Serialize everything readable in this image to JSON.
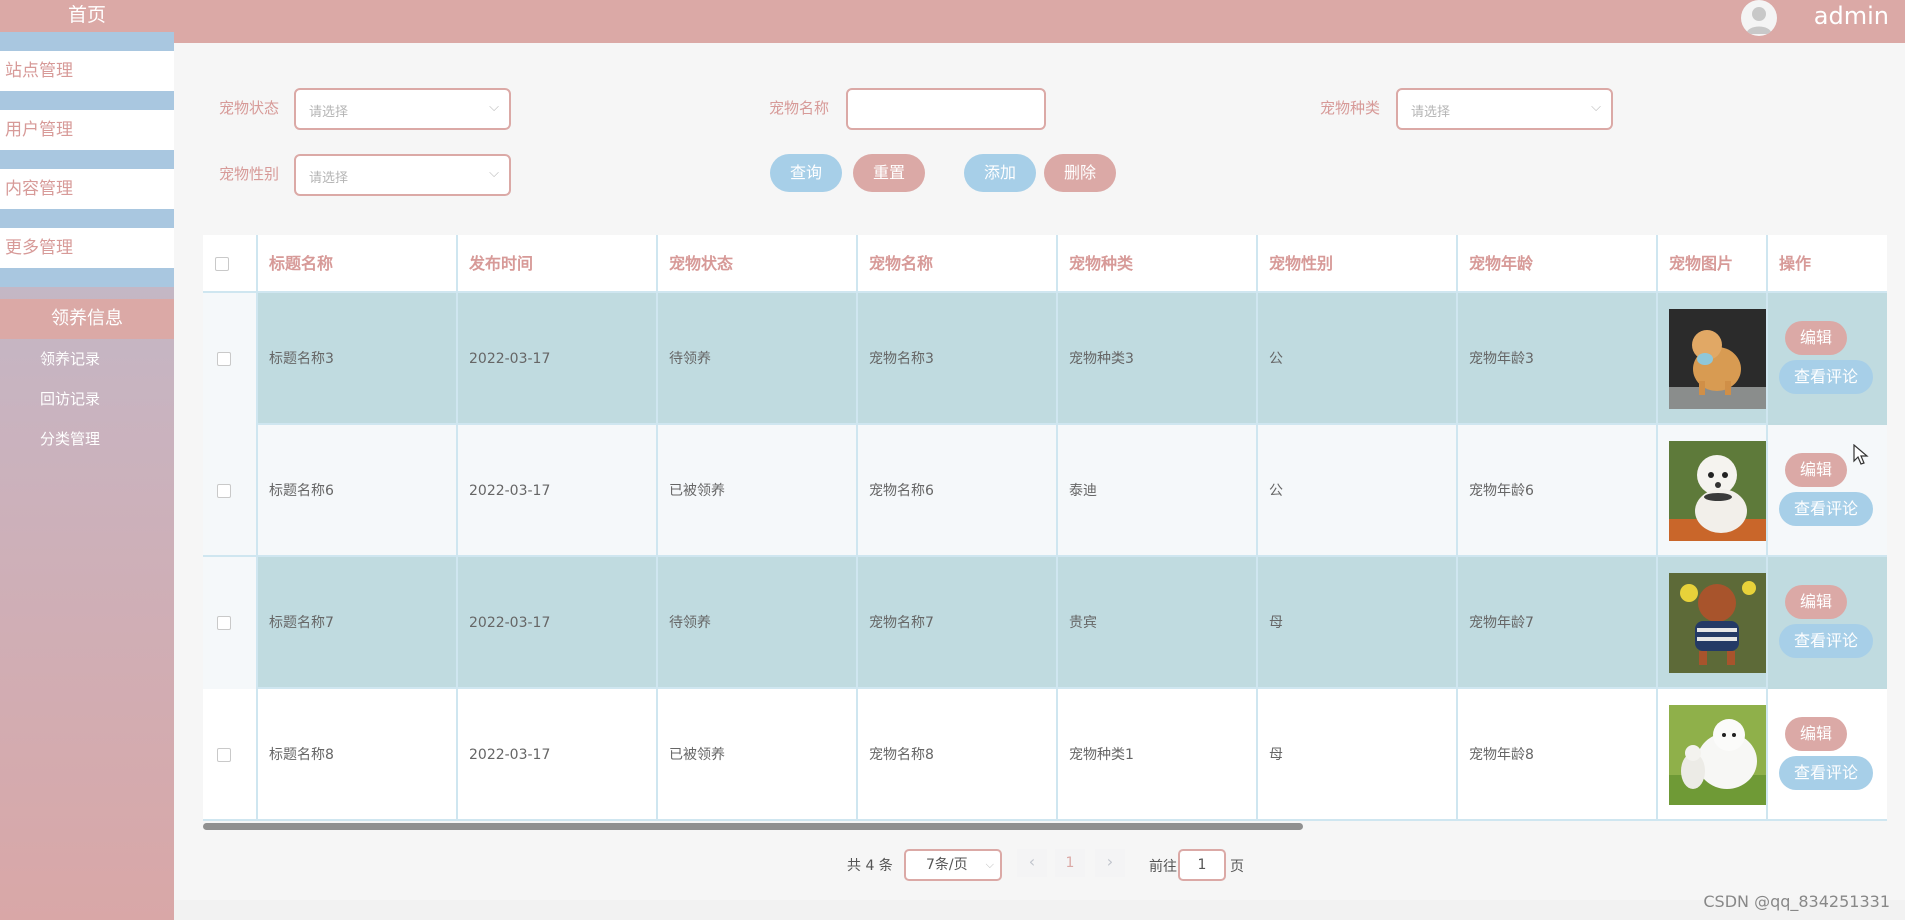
{
  "sidebar": {
    "home": "首页",
    "menus": [
      "站点管理",
      "用户管理",
      "内容管理",
      "更多管理"
    ],
    "active_group": "领养信息",
    "sub_items": [
      "领养记录",
      "回访记录",
      "分类管理"
    ]
  },
  "header": {
    "username": "admin"
  },
  "filters": {
    "status_label": "宠物状态",
    "status_placeholder": "请选择",
    "name_label": "宠物名称",
    "name_value": "",
    "type_label": "宠物种类",
    "type_placeholder": "请选择",
    "gender_label": "宠物性别",
    "gender_placeholder": "请选择"
  },
  "buttons": {
    "query": "查询",
    "reset": "重置",
    "add": "添加",
    "delete": "删除"
  },
  "table": {
    "columns": [
      "标题名称",
      "发布时间",
      "宠物状态",
      "宠物名称",
      "宠物种类",
      "宠物性别",
      "宠物年龄",
      "宠物图片",
      "操作"
    ],
    "rows": [
      {
        "title": "标题名称3",
        "date": "2022-03-17",
        "status": "待领养",
        "name": "宠物名称3",
        "type": "宠物种类3",
        "gender": "公",
        "age": "宠物年龄3",
        "edit": "编辑",
        "view": "查看评论"
      },
      {
        "title": "标题名称6",
        "date": "2022-03-17",
        "status": "已被领养",
        "name": "宠物名称6",
        "type": "泰迪",
        "gender": "公",
        "age": "宠物年龄6",
        "edit": "编辑",
        "view": "查看评论"
      },
      {
        "title": "标题名称7",
        "date": "2022-03-17",
        "status": "待领养",
        "name": "宠物名称7",
        "type": "贵宾",
        "gender": "母",
        "age": "宠物年龄7",
        "edit": "编辑",
        "view": "查看评论"
      },
      {
        "title": "标题名称8",
        "date": "2022-03-17",
        "status": "已被领养",
        "name": "宠物名称8",
        "type": "宠物种类1",
        "gender": "母",
        "age": "宠物年龄8",
        "edit": "编辑",
        "view": "查看评论"
      }
    ]
  },
  "pagination": {
    "total": "共 4 条",
    "page_size": "7条/页",
    "prev": "‹",
    "current": "1",
    "next": "›",
    "goto_label": "前往",
    "goto_value": "1",
    "page_suffix": "页"
  },
  "watermark": "CSDN @qq_834251331",
  "colors": {
    "accent_pink": "#dba9a6",
    "accent_blue": "#a7cfe8",
    "row_teal": "#c0dbe0"
  }
}
